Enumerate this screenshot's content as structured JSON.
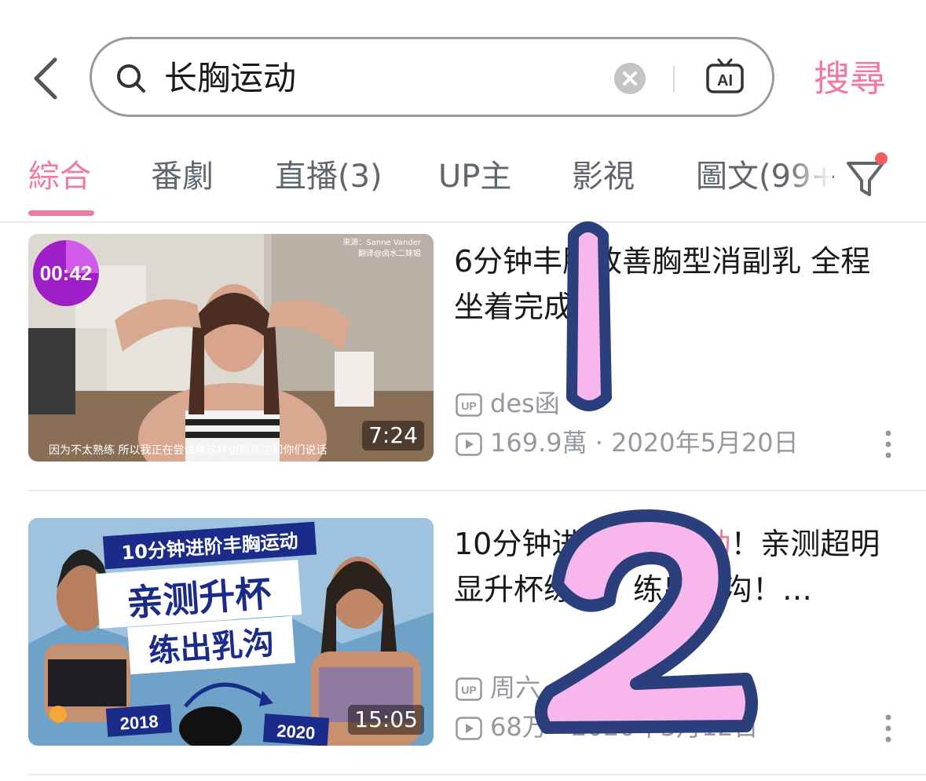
{
  "search": {
    "query": "长胸运动",
    "button": "搜尋",
    "ai_icon": "ai-icon"
  },
  "tabs": [
    {
      "label": "綜合",
      "active": true
    },
    {
      "label": "番劇",
      "active": false
    },
    {
      "label": "直播(3)",
      "active": false
    },
    {
      "label": "UP主",
      "active": false
    },
    {
      "label": "影視",
      "active": false
    },
    {
      "label": "圖文(99+",
      "active": false
    }
  ],
  "videos": [
    {
      "title": "6分钟丰胸改善胸型消副乳 全程坐着完成！",
      "thumb_timer": "00:42",
      "thumb_credit_1": "来源：Sanne Vander",
      "thumb_credit_2": "翻译@卤水二妹姐",
      "thumb_subtitle": "因为不太熟练 所以我正在尝试像这样边锻炼边和你们说话",
      "duration": "7:24",
      "up_name": "des函",
      "stats": "169.9萬 · 2020年5月20日"
    },
    {
      "title_before": "10分钟进阶丰胸运",
      "title_highlight": "动",
      "title_after": "！亲测超明显升杯练胸，练出乳沟！…",
      "thumb_banner": "10分钟进阶丰胸运动",
      "thumb_big_1": "亲测升杯",
      "thumb_big_2": "练出乳沟",
      "thumb_year_left": "2018",
      "thumb_year_right": "2020",
      "duration": "15:05",
      "up_name": "周六",
      "stats": "68万 · 2020年3月12日"
    }
  ],
  "overlay": {
    "sticker_1": "1",
    "sticker_2": "2"
  },
  "colors": {
    "accent": "#f07aa0",
    "text": "#18191c",
    "secondary": "#9499a0",
    "sticker_fill": "#f7b7ec",
    "sticker_stroke": "#2c3f7d"
  }
}
